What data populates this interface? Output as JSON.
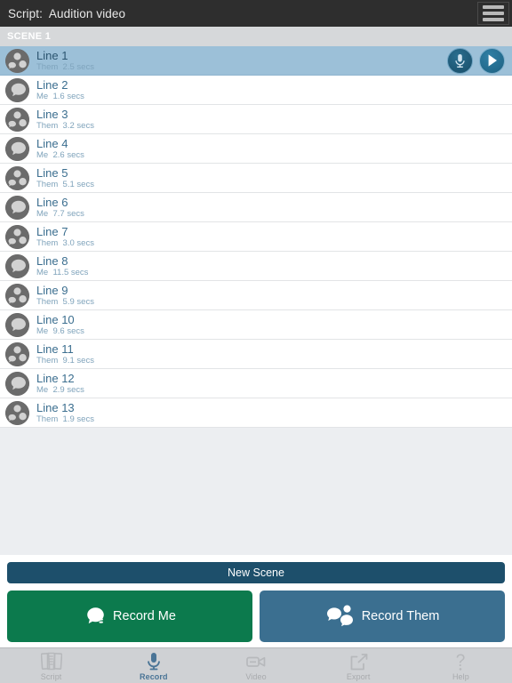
{
  "topbar": {
    "title": "Script:  Audition video",
    "menu_icon": "hamburger-icon"
  },
  "scene": {
    "header_label": "SCENE 1"
  },
  "colors": {
    "topbar_bg": "#2e2e2e",
    "scene_header_bg": "#d6d8da",
    "selected_row_bg": "#9cc0d8",
    "row_title": "#3b6e8f",
    "row_sub": "#7fa3bb",
    "new_scene_btn": "#1d4f6b",
    "record_me_btn": "#0c7a4d",
    "record_them_btn": "#3b6f90",
    "tabbar_bg": "#cfd1d4",
    "tab_active": "#4a7496",
    "tab_inactive": "#a8aaad",
    "list_bg": "#ffffff",
    "empty_area_bg": "#eceef1"
  },
  "lines": [
    {
      "title": "Line 1",
      "speaker": "Them",
      "duration": "2.5 secs",
      "avatar": "group-avatar-icon",
      "selected": true,
      "sub": "Them  2.5 secs"
    },
    {
      "title": "Line 2",
      "speaker": "Me",
      "duration": "1.6 secs",
      "avatar": "person-avatar-icon",
      "selected": false,
      "sub": "Me  1.6 secs"
    },
    {
      "title": "Line 3",
      "speaker": "Them",
      "duration": "3.2 secs",
      "avatar": "group-avatar-icon",
      "selected": false,
      "sub": "Them  3.2 secs"
    },
    {
      "title": "Line 4",
      "speaker": "Me",
      "duration": "2.6 secs",
      "avatar": "person-avatar-icon",
      "selected": false,
      "sub": "Me  2.6 secs"
    },
    {
      "title": "Line 5",
      "speaker": "Them",
      "duration": "5.1 secs",
      "avatar": "group-avatar-icon",
      "selected": false,
      "sub": "Them  5.1 secs"
    },
    {
      "title": "Line 6",
      "speaker": "Me",
      "duration": "7.7 secs",
      "avatar": "person-avatar-icon",
      "selected": false,
      "sub": "Me  7.7 secs"
    },
    {
      "title": "Line 7",
      "speaker": "Them",
      "duration": "3.0 secs",
      "avatar": "group-avatar-icon",
      "selected": false,
      "sub": "Them  3.0 secs"
    },
    {
      "title": "Line 8",
      "speaker": "Me",
      "duration": "11.5 secs",
      "avatar": "person-avatar-icon",
      "selected": false,
      "sub": "Me  11.5 secs"
    },
    {
      "title": "Line 9",
      "speaker": "Them",
      "duration": "5.9 secs",
      "avatar": "group-avatar-icon",
      "selected": false,
      "sub": "Them  5.9 secs"
    },
    {
      "title": "Line 10",
      "speaker": "Me",
      "duration": "9.6 secs",
      "avatar": "person-avatar-icon",
      "selected": false,
      "sub": "Me  9.6 secs"
    },
    {
      "title": "Line 11",
      "speaker": "Them",
      "duration": "9.1 secs",
      "avatar": "group-avatar-icon",
      "selected": false,
      "sub": "Them  9.1 secs"
    },
    {
      "title": "Line 12",
      "speaker": "Me",
      "duration": "2.9 secs",
      "avatar": "person-avatar-icon",
      "selected": false,
      "sub": "Me  2.9 secs"
    },
    {
      "title": "Line 13",
      "speaker": "Them",
      "duration": "1.9 secs",
      "avatar": "group-avatar-icon",
      "selected": false,
      "sub": "Them  1.9 secs"
    }
  ],
  "row_actions": {
    "record_icon": "microphone-icon",
    "play_icon": "play-icon"
  },
  "actions": {
    "new_scene_label": "New Scene",
    "record_me_label": "Record Me",
    "record_me_icon": "person-icon",
    "record_them_label": "Record Them",
    "record_them_icon": "people-icon"
  },
  "tabs": [
    {
      "label": "Script",
      "icon": "documents-icon",
      "active": false
    },
    {
      "label": "Record",
      "icon": "microphone-icon",
      "active": true
    },
    {
      "label": "Video",
      "icon": "camcorder-icon",
      "active": false
    },
    {
      "label": "Export",
      "icon": "share-icon",
      "active": false
    },
    {
      "label": "Help",
      "icon": "question-icon",
      "active": false
    }
  ]
}
